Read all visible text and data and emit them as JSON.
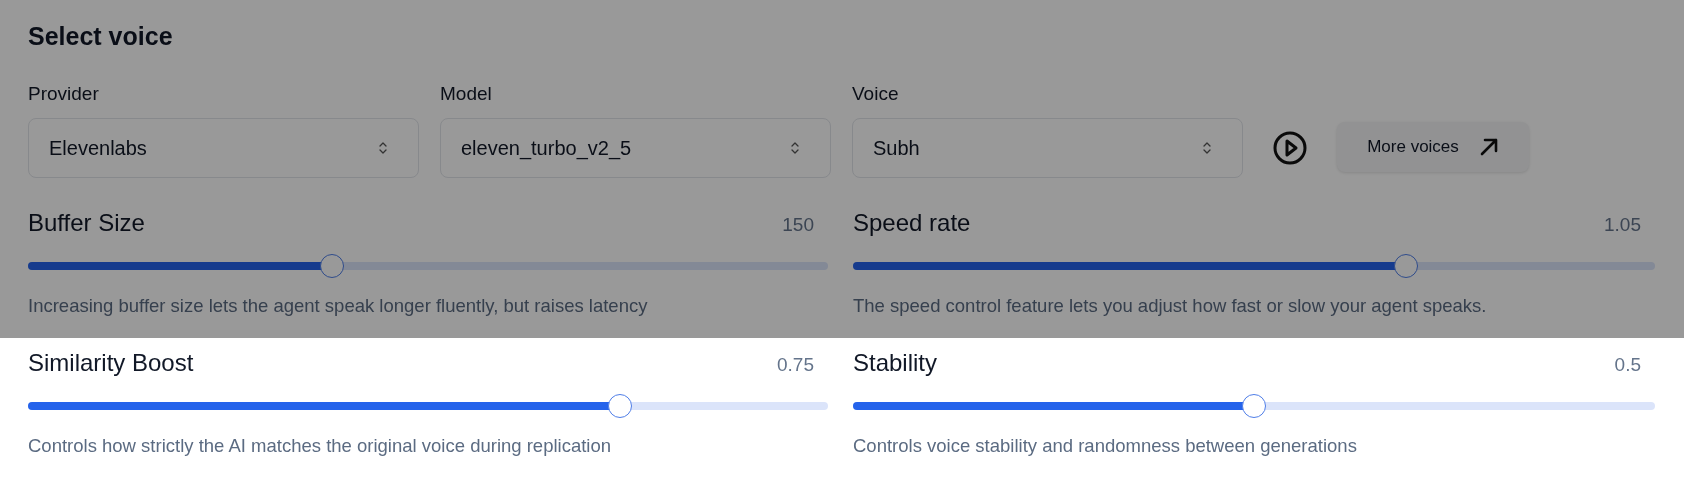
{
  "panels": [
    {
      "dimmed": true,
      "title": "Select voice",
      "selects": [
        {
          "label": "Provider",
          "value": "Elevenlabs"
        },
        {
          "label": "Model",
          "value": "eleven_turbo_v2_5"
        },
        {
          "label": "Voice",
          "value": "Subh"
        }
      ],
      "more_voices": "More voices",
      "sliders": [
        {
          "name": "Buffer Size",
          "reading": "150",
          "level": 0.38,
          "description": "Increasing buffer size lets the agent speak longer fluently, but raises latency"
        },
        {
          "name": "Speed rate",
          "reading": "1.05",
          "level": 0.69,
          "description": "The speed control feature lets you adjust how fast or slow your agent speaks."
        }
      ]
    },
    {
      "sliders": [
        {
          "name": "Similarity Boost",
          "reading": "0.75",
          "level": 0.74,
          "description": "Controls how strictly the AI matches the original voice during replication"
        },
        {
          "name": "Stability",
          "reading": "0.5",
          "level": 0.5,
          "description": "Controls voice stability and randomness between generations"
        }
      ]
    }
  ]
}
